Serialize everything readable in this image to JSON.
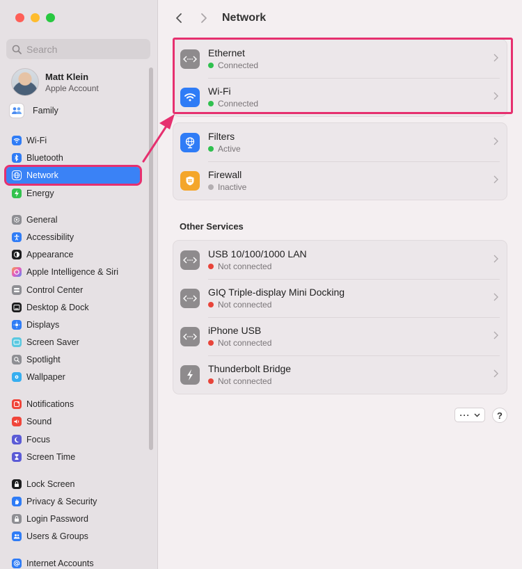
{
  "window": {
    "title": "Network"
  },
  "search": {
    "placeholder": "Search"
  },
  "account": {
    "name": "Matt Klein",
    "subtitle": "Apple Account"
  },
  "sidebar": {
    "items": [
      {
        "label": "Family",
        "icon": "family-icon",
        "color": "#ffffff"
      },
      {
        "label": "Wi-Fi",
        "icon": "wifi-icon",
        "color": "#2f7cf6"
      },
      {
        "label": "Bluetooth",
        "icon": "bluetooth-icon",
        "color": "#2f7cf6"
      },
      {
        "label": "Network",
        "icon": "network-icon",
        "color": "#2f7cf6",
        "selected": true
      },
      {
        "label": "Energy",
        "icon": "energy-icon",
        "color": "#33c24d"
      },
      {
        "label": "General",
        "icon": "gear-icon",
        "color": "#8e8e93"
      },
      {
        "label": "Accessibility",
        "icon": "accessibility-icon",
        "color": "#2f7cf6"
      },
      {
        "label": "Appearance",
        "icon": "appearance-icon",
        "color": "#1c1c1e"
      },
      {
        "label": "Apple Intelligence & Siri",
        "icon": "siri-icon",
        "color": "#d96fd6"
      },
      {
        "label": "Control Center",
        "icon": "control-center-icon",
        "color": "#8e8e93"
      },
      {
        "label": "Desktop & Dock",
        "icon": "dock-icon",
        "color": "#1c1c1e"
      },
      {
        "label": "Displays",
        "icon": "displays-icon",
        "color": "#2f7cf6"
      },
      {
        "label": "Screen Saver",
        "icon": "screen-saver-icon",
        "color": "#5ac8e0"
      },
      {
        "label": "Spotlight",
        "icon": "spotlight-icon",
        "color": "#8e8e93"
      },
      {
        "label": "Wallpaper",
        "icon": "wallpaper-icon",
        "color": "#36aef0"
      },
      {
        "label": "Notifications",
        "icon": "notifications-icon",
        "color": "#f0453a"
      },
      {
        "label": "Sound",
        "icon": "sound-icon",
        "color": "#f0453a"
      },
      {
        "label": "Focus",
        "icon": "focus-icon",
        "color": "#5b5bd6"
      },
      {
        "label": "Screen Time",
        "icon": "screen-time-icon",
        "color": "#5b5bd6"
      },
      {
        "label": "Lock Screen",
        "icon": "lock-icon",
        "color": "#1c1c1e"
      },
      {
        "label": "Privacy & Security",
        "icon": "hand-icon",
        "color": "#2f7cf6"
      },
      {
        "label": "Login Password",
        "icon": "password-icon",
        "color": "#8e8e93"
      },
      {
        "label": "Users & Groups",
        "icon": "users-icon",
        "color": "#2f7cf6"
      },
      {
        "label": "Internet Accounts",
        "icon": "at-icon",
        "color": "#2f7cf6"
      }
    ]
  },
  "main": {
    "primary": [
      {
        "name": "Ethernet",
        "status": "Connected",
        "status_color": "#30c04f",
        "icon": "ethernet-icon"
      },
      {
        "name": "Wi-Fi",
        "status": "Connected",
        "status_color": "#30c04f",
        "icon": "wifi-icon"
      }
    ],
    "secondary": [
      {
        "name": "Filters",
        "status": "Active",
        "status_color": "#30c04f",
        "icon": "globe-filter-icon"
      },
      {
        "name": "Firewall",
        "status": "Inactive",
        "status_color": "#b3aeb1",
        "icon": "firewall-icon"
      }
    ],
    "other_title": "Other Services",
    "other": [
      {
        "name": "USB 10/100/1000 LAN",
        "status": "Not connected",
        "status_color": "#e8443a",
        "icon": "ethernet-icon"
      },
      {
        "name": "GIQ Triple-display Mini Docking",
        "status": "Not connected",
        "status_color": "#e8443a",
        "icon": "ethernet-icon"
      },
      {
        "name": "iPhone USB",
        "status": "Not connected",
        "status_color": "#e8443a",
        "icon": "ethernet-icon"
      },
      {
        "name": "Thunderbolt Bridge",
        "status": "Not connected",
        "status_color": "#e8443a",
        "icon": "thunderbolt-icon"
      }
    ],
    "more_label": "···",
    "help_label": "?"
  },
  "colors": {
    "accent": "#3a82f6",
    "highlight": "#e6306f"
  }
}
